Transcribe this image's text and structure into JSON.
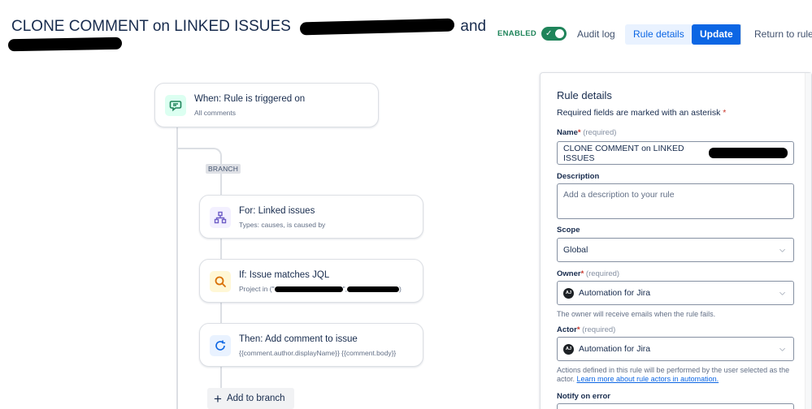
{
  "header": {
    "title": "CLONE COMMENT on LINKED ISSUES",
    "title_tail": "and",
    "enabled_label": "ENABLED",
    "audit_log": "Audit log",
    "rule_details": "Rule details",
    "update": "Update",
    "return": "Return to rules"
  },
  "flow": {
    "trigger": {
      "title": "When: Rule is triggered on",
      "subtitle": "All comments",
      "icon": "comment-icon"
    },
    "branch_tag": "BRANCH",
    "branch": {
      "title": "For: Linked issues",
      "subtitle": "Types: causes, is caused by",
      "icon": "hierarchy-icon"
    },
    "condition": {
      "title": "If: Issue matches JQL",
      "subtitle_prefix": "Project in (\"",
      "subtitle_mid": "\",",
      "subtitle_suffix": ")",
      "icon": "search-icon"
    },
    "action": {
      "title": "Then: Add comment to issue",
      "subtitle": "{{comment.author.displayName}} {{comment.body}}",
      "icon": "refresh-comment-icon"
    },
    "add_branch": "Add to branch"
  },
  "panel": {
    "title": "Rule details",
    "required_note": "Required fields are marked with an asterisk",
    "name_label": "Name",
    "required_text": "(required)",
    "name_value": "CLONE COMMENT on LINKED ISSUES",
    "description_label": "Description",
    "description_placeholder": "Add a description to your rule",
    "scope_label": "Scope",
    "scope_value": "Global",
    "owner_label": "Owner",
    "owner_value": "Automation for Jira",
    "owner_help": "The owner will receive emails when the rule fails.",
    "actor_label": "Actor",
    "actor_value": "Automation for Jira",
    "actor_help": "Actions defined in this rule will be performed by the user selected as the actor.",
    "actor_link": "Learn more about rule actors in automation.",
    "notify_label": "Notify on error",
    "avatar_initials": "AJ"
  },
  "colors": {
    "accent": "#0c66e4",
    "enabled_green": "#1f845a",
    "trigger_icon_bg": "#dcfff1",
    "branch_icon_bg": "#f3f0ff",
    "condition_icon_bg": "#fff7d6",
    "action_icon_bg": "#e9f2ff"
  }
}
